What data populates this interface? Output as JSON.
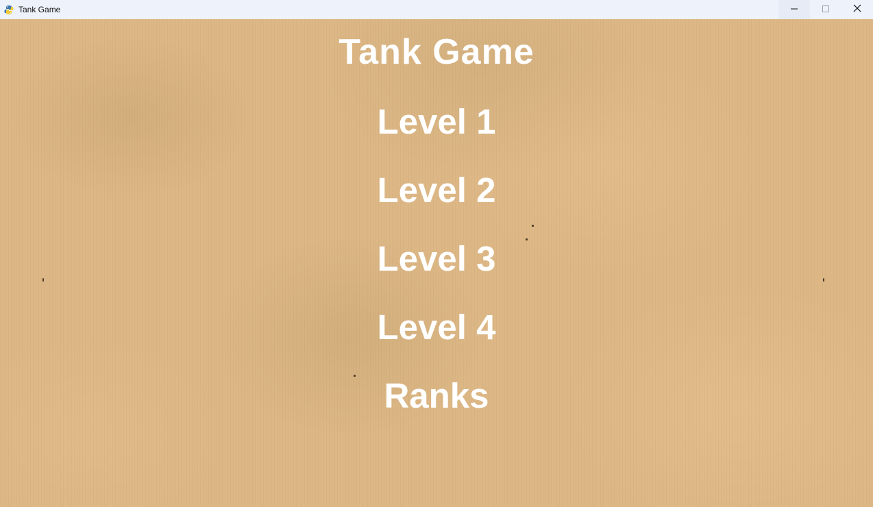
{
  "window": {
    "title": "Tank Game",
    "icon": "python-snake-icon"
  },
  "controls": {
    "minimize": "minimize-icon",
    "maximize": "maximize-icon",
    "close": "close-icon"
  },
  "menu": {
    "title": "Tank Game",
    "items": [
      {
        "label": "Level 1"
      },
      {
        "label": "Level 2"
      },
      {
        "label": "Level 3"
      },
      {
        "label": "Level 4"
      },
      {
        "label": "Ranks"
      }
    ]
  },
  "colors": {
    "background": "#ddb886",
    "text": "#ffffff",
    "titlebar": "#eef2fb"
  }
}
